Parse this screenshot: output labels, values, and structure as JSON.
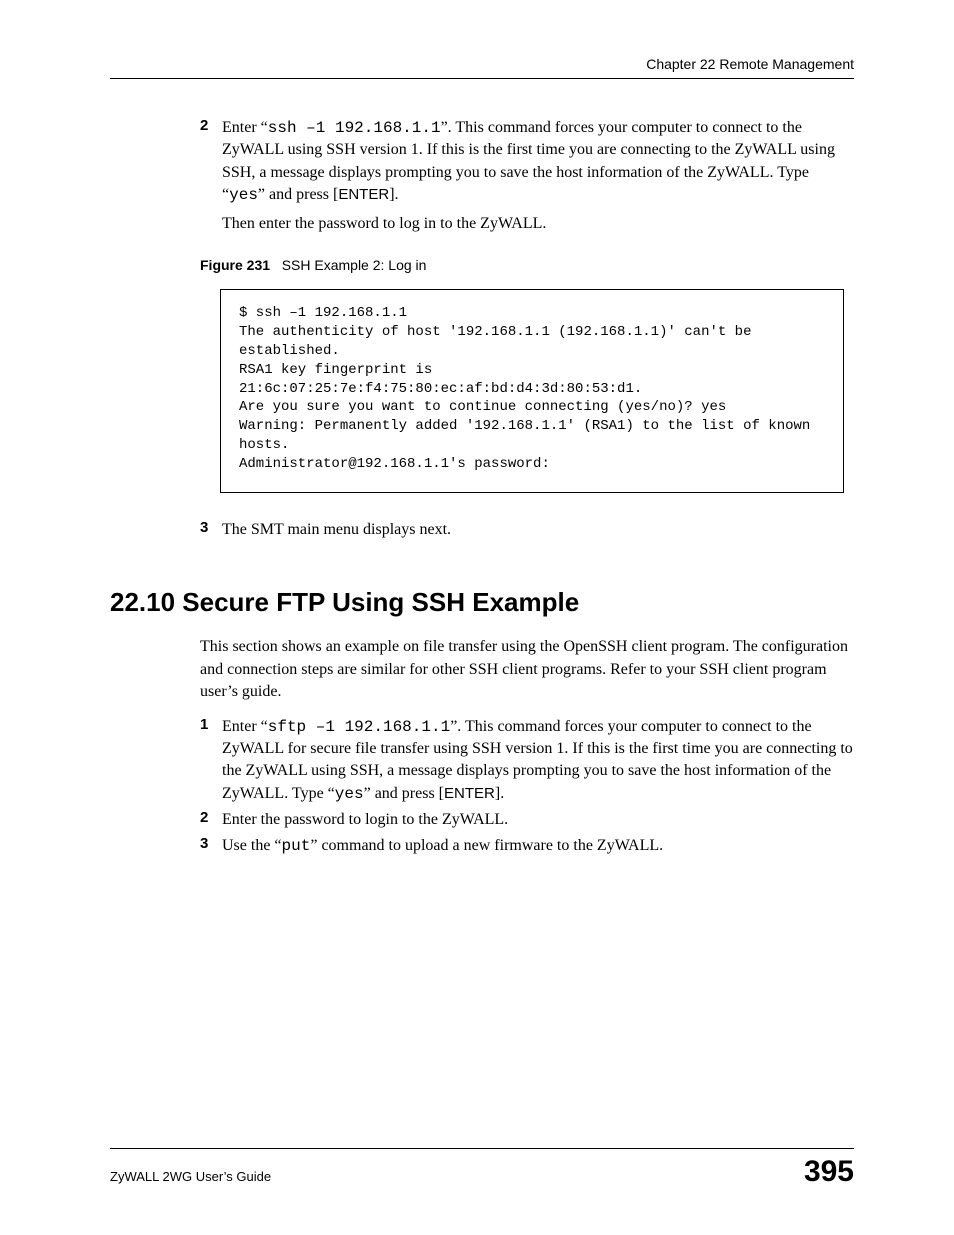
{
  "header": {
    "chapter": "Chapter 22 Remote Management"
  },
  "step2": {
    "num": "2",
    "t1": "Enter “",
    "cmd": "ssh –1 192.168.1.1",
    "t2": "”. This command forces your computer to connect to the ZyWALL using SSH version 1. If this is the first time you are connecting to the ZyWALL using SSH, a message displays prompting you to save the host information of the ZyWALL. Type “",
    "yes": "yes",
    "t3": "” and press [",
    "enter": "ENTER",
    "t4": "].",
    "then": "Then enter the password to log in to the ZyWALL."
  },
  "figure": {
    "label": "Figure 231",
    "caption": "SSH Example 2: Log in",
    "code": "$ ssh –1 192.168.1.1\nThe authenticity of host '192.168.1.1 (192.168.1.1)' can't be established.\nRSA1 key fingerprint is 21:6c:07:25:7e:f4:75:80:ec:af:bd:d4:3d:80:53:d1.\nAre you sure you want to continue connecting (yes/no)? yes\nWarning: Permanently added '192.168.1.1' (RSA1) to the list of known hosts.\nAdministrator@192.168.1.1's password:"
  },
  "step3": {
    "num": "3",
    "text": "The SMT main menu displays next."
  },
  "section": {
    "title": "22.10  Secure FTP Using SSH Example",
    "intro": "This section shows an example on file transfer using the OpenSSH client program. The configuration and connection steps are similar for other SSH client programs. Refer to your SSH client program user’s guide."
  },
  "sftp1": {
    "num": "1",
    "t1": "Enter “",
    "cmd": "sftp –1 192.168.1.1",
    "t2": "”. This command forces your computer to connect to the ZyWALL for secure file transfer using SSH version 1. If this is the first time you are connecting to the ZyWALL using SSH, a message displays prompting you to save the host information of the ZyWALL. Type “",
    "yes": "yes",
    "t3": "” and press [",
    "enter": "ENTER",
    "t4": "]."
  },
  "sftp2": {
    "num": "2",
    "text": "Enter the password to login to the ZyWALL."
  },
  "sftp3": {
    "num": "3",
    "t1": "Use the “",
    "put": "put",
    "t2": "” command to upload a new firmware to the ZyWALL."
  },
  "footer": {
    "guide": "ZyWALL 2WG User’s Guide",
    "page": "395"
  }
}
